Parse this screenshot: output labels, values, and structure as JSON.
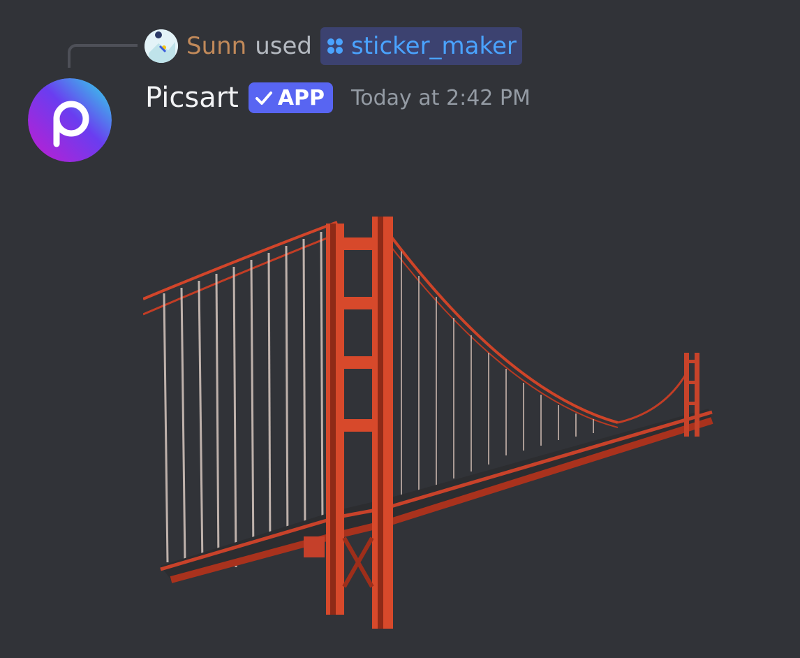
{
  "reply": {
    "username": "Sunn",
    "action": "used",
    "command": "sticker_maker",
    "user_color": "#c28a5a",
    "command_color": "#4aa3ff"
  },
  "message": {
    "bot_name": "Picsart",
    "badge": "APP",
    "badge_color": "#5865f2",
    "timestamp": "Today at 2:42 PM",
    "avatar_icon": "picsart-logo",
    "attachment": "golden-gate-bridge-sticker"
  }
}
